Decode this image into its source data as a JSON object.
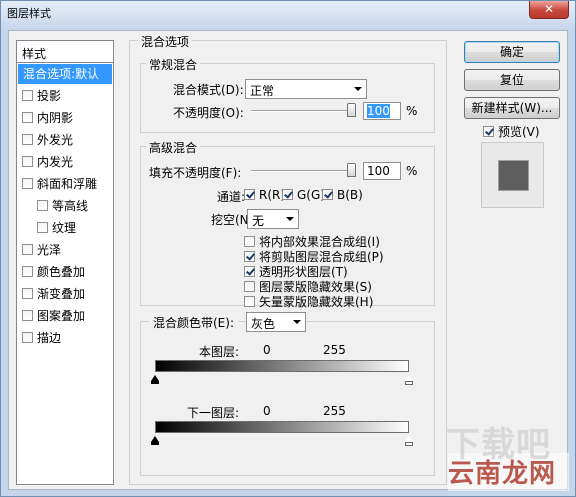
{
  "window": {
    "title": "图层样式",
    "close_glyph": "✕"
  },
  "style_list": {
    "header": "样式",
    "items": [
      {
        "label": "混合选项:默认",
        "selected": true,
        "has_checkbox": false,
        "sub": false
      },
      {
        "label": "投影",
        "has_checkbox": true,
        "sub": false
      },
      {
        "label": "内阴影",
        "has_checkbox": true,
        "sub": false
      },
      {
        "label": "外发光",
        "has_checkbox": true,
        "sub": false
      },
      {
        "label": "内发光",
        "has_checkbox": true,
        "sub": false
      },
      {
        "label": "斜面和浮雕",
        "has_checkbox": true,
        "sub": false
      },
      {
        "label": "等高线",
        "has_checkbox": true,
        "sub": true
      },
      {
        "label": "纹理",
        "has_checkbox": true,
        "sub": true
      },
      {
        "label": "光泽",
        "has_checkbox": true,
        "sub": false
      },
      {
        "label": "颜色叠加",
        "has_checkbox": true,
        "sub": false
      },
      {
        "label": "渐变叠加",
        "has_checkbox": true,
        "sub": false
      },
      {
        "label": "图案叠加",
        "has_checkbox": true,
        "sub": false
      },
      {
        "label": "描边",
        "has_checkbox": true,
        "sub": false
      }
    ]
  },
  "blend_options": {
    "title": "混合选项",
    "general": {
      "title": "常规混合",
      "mode_label": "混合模式(D):",
      "mode_value": "正常",
      "opacity_label": "不透明度(O):",
      "opacity_value": "100",
      "percent": "%"
    },
    "advanced": {
      "title": "高级混合",
      "fill_label": "填充不透明度(F):",
      "fill_value": "100",
      "percent": "%",
      "channels_label": "通道:",
      "channels": [
        {
          "label": "R(R)",
          "checked": true
        },
        {
          "label": "G(G)",
          "checked": true
        },
        {
          "label": "B(B)",
          "checked": true
        }
      ],
      "knockout_label": "挖空(N):",
      "knockout_value": "无",
      "options": [
        {
          "label": "将内部效果混合成组(I)",
          "checked": false
        },
        {
          "label": "将剪贴图层混合成组(P)",
          "checked": true
        },
        {
          "label": "透明形状图层(T)",
          "checked": true
        },
        {
          "label": "图层蒙版隐藏效果(S)",
          "checked": false
        },
        {
          "label": "矢量蒙版隐藏效果(H)",
          "checked": false
        }
      ]
    },
    "blend_if": {
      "label": "混合颜色带(E):",
      "value": "灰色",
      "this_layer": {
        "label": "本图层:",
        "low": "0",
        "high": "255"
      },
      "underlying": {
        "label": "下一图层:",
        "low": "0",
        "high": "255"
      }
    }
  },
  "buttons": {
    "ok": "确定",
    "reset": "复位",
    "new_style": "新建样式(W)...",
    "preview_label": "预览(V)",
    "preview_checked": true
  },
  "watermark": {
    "ghost_text": "下载吧",
    "brand_text": "云南龙网"
  },
  "colors": {
    "selection": "#3399ff",
    "preview_swatch": "#5e5e5e",
    "close_button": "#c7473a"
  }
}
